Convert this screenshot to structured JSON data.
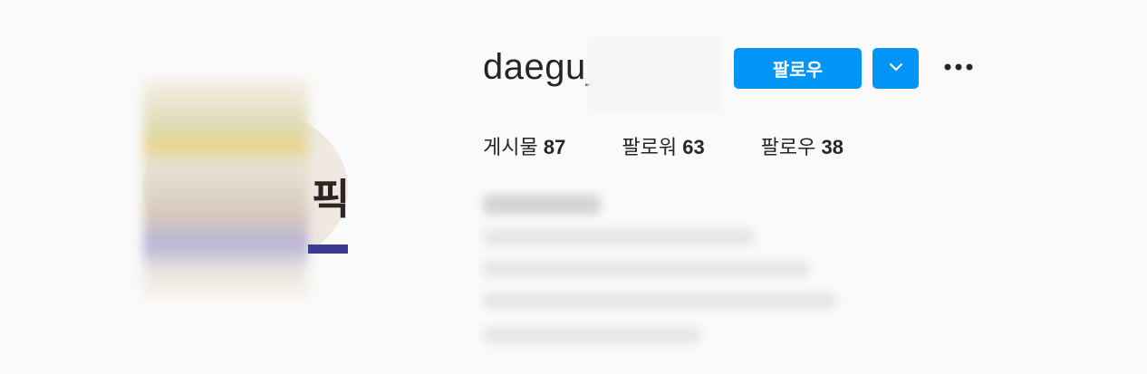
{
  "profile": {
    "username_visible": "daegu_",
    "follow_label": "팔로우",
    "stats": {
      "posts_label": "게시물",
      "posts_count": "87",
      "followers_label": "팔로워",
      "followers_count": "63",
      "following_label": "팔로우",
      "following_count": "38"
    },
    "avatar_glyph": "픽"
  },
  "icons": {
    "dropdown": "chevron-down-icon",
    "more": "more-horizontal-icon"
  },
  "colors": {
    "accent": "#0095f6",
    "text": "#262626",
    "background": "#fafafa"
  }
}
